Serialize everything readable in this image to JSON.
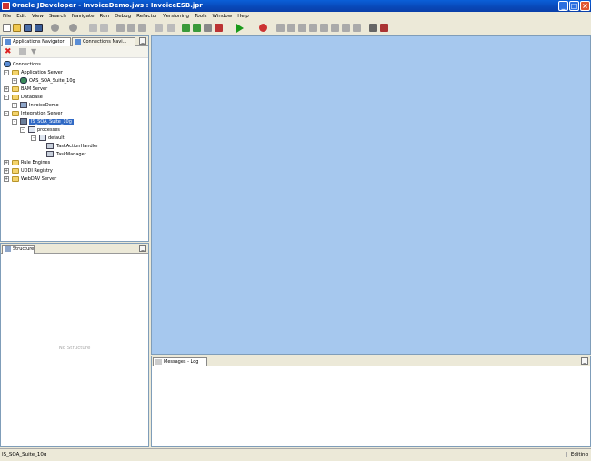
{
  "window": {
    "title": "Oracle JDeveloper - InvoiceDemo.jws : InvoiceESB.jpr",
    "minimize": "_",
    "maximize": "□",
    "close": "×"
  },
  "menu": [
    "File",
    "Edit",
    "View",
    "Search",
    "Navigate",
    "Run",
    "Debug",
    "Refactor",
    "Versioning",
    "Tools",
    "Window",
    "Help"
  ],
  "navigator": {
    "tabs": [
      "Applications Navigator",
      "Connections Navi..."
    ],
    "minimize": "_",
    "tree": [
      {
        "label": "Connections"
      },
      {
        "label": "Application Server"
      },
      {
        "label": "OAS_SOA_Suite_10g"
      },
      {
        "label": "BAM Server"
      },
      {
        "label": "Database"
      },
      {
        "label": "InvoiceDemo"
      },
      {
        "label": "Integration Server"
      },
      {
        "label": "IS_SOA_Suite_10g"
      },
      {
        "label": "processes"
      },
      {
        "label": "default"
      },
      {
        "label": "TaskActionHandler"
      },
      {
        "label": "TaskManager"
      },
      {
        "label": "Rule Engines"
      },
      {
        "label": "UDDI Registry"
      },
      {
        "label": "WebDAV Server"
      }
    ],
    "expanders": {
      "collapsed": "+",
      "expanded": "-"
    }
  },
  "structure": {
    "tab": "Structure",
    "empty_text": "No Structure",
    "minimize": "_"
  },
  "messages": {
    "tab": "Messages - Log",
    "minimize": "_"
  },
  "status": {
    "left": "IS_SOA_Suite_10g",
    "right": "Editing"
  },
  "colors": {
    "editor_bg": "#a6c8ee",
    "selection": "#316ac5",
    "titlebar": "#0a5fd8"
  }
}
